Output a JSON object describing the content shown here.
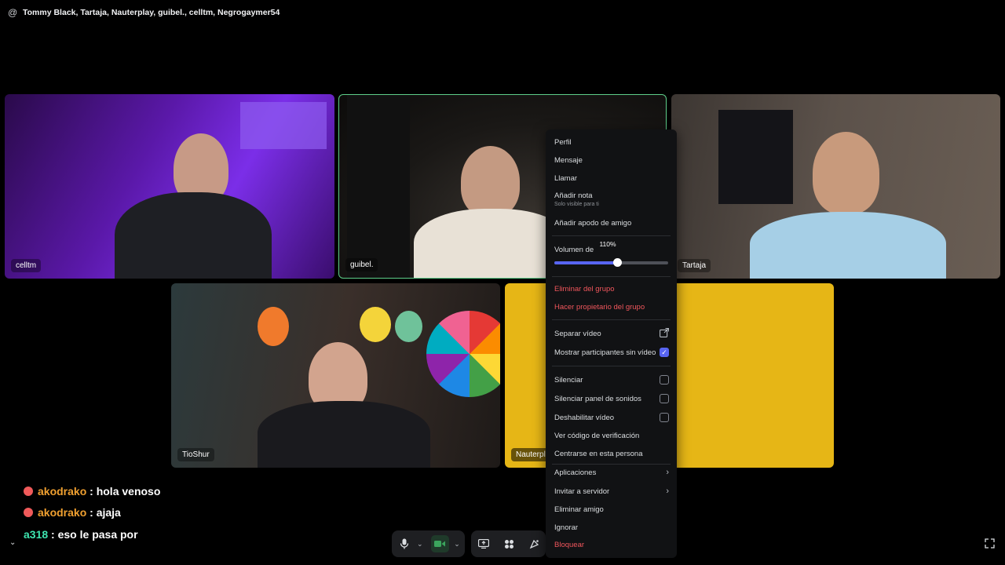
{
  "header": {
    "at_icon": "@",
    "title": "Tommy Black, Tartaja, Nauterplay, guibel., celltm, Negrogaymer54"
  },
  "tiles": {
    "celltm": "celltm",
    "guibel": "guibel.",
    "tartaja": "Tartaja",
    "tioshur": "TioShur",
    "nauterplay": "Nauterpl"
  },
  "chat": [
    {
      "user": "akodrako",
      "sep": " : ",
      "msg": "hola venoso"
    },
    {
      "user": "akodrako",
      "sep": " : ",
      "msg": "ajaja"
    },
    {
      "user": "a318",
      "sep": " : ",
      "msg": "eso le pasa por"
    }
  ],
  "menu": {
    "perfil": "Perfil",
    "mensaje": "Mensaje",
    "llamar": "Llamar",
    "anadir_nota": "Añadir nota",
    "anadir_nota_sub": "Solo visible para ti",
    "apodo": "Añadir apodo de amigo",
    "volumen": "Volumen de",
    "volumen_value": "110%",
    "volumen_fraction": 0.55,
    "eliminar_grupo": "Eliminar del grupo",
    "propietario": "Hacer propietario del grupo",
    "separar_video": "Separar vídeo",
    "mostrar_sin_video": "Mostrar participantes sin vídeo",
    "silenciar": "Silenciar",
    "silenciar_panel": "Silenciar panel de sonidos",
    "deshabilitar_video": "Deshabilitar vídeo",
    "ver_codigo": "Ver código de verificación",
    "centrarse": "Centrarse en esta persona",
    "aplicaciones": "Aplicaciones",
    "invitar": "Invitar a servidor",
    "eliminar_amigo": "Eliminar amigo",
    "ignorar": "Ignorar",
    "bloquear": "Bloquear"
  },
  "colors": {
    "accent": "#5865f2",
    "danger": "#f0565c",
    "speaking": "#5ecf8a",
    "chat_user": "#f0a030"
  },
  "icons": [
    "at-icon",
    "mic-icon",
    "camera-icon",
    "screen-share-icon",
    "activities-icon",
    "soundboard-icon",
    "fullscreen-icon",
    "chevron-down-icon",
    "external-link-icon",
    "chevron-right-icon",
    "checkbox-icon"
  ]
}
